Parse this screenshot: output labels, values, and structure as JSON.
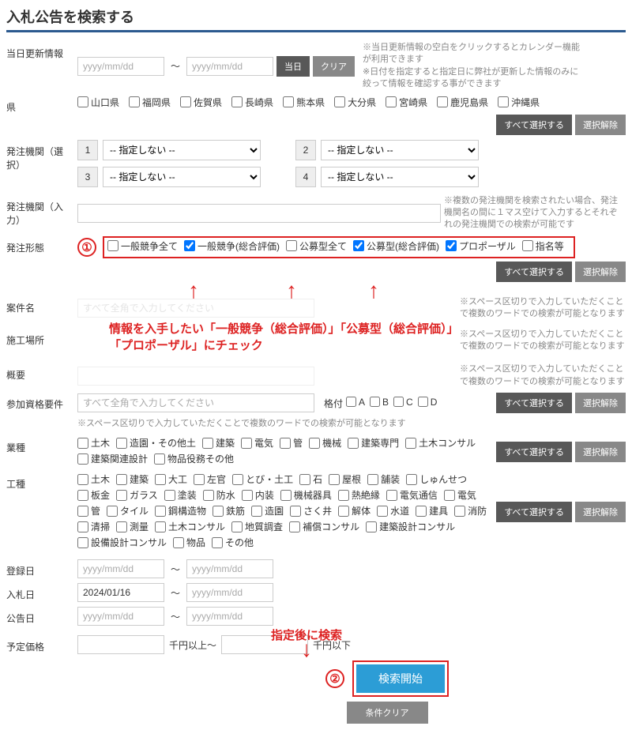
{
  "title": "入札公告を検索する",
  "labels": {
    "updateInfo": "当日更新情報",
    "pref": "県",
    "orgSelect": "発注機関（選択）",
    "orgInput": "発注機関（入力）",
    "bidType": "発注形態",
    "caseName": "案件名",
    "workPlace": "施工場所",
    "summary": "概要",
    "qualReq": "参加資格要件",
    "industry": "業種",
    "workType": "工種",
    "regDate": "登録日",
    "bidDate": "入札日",
    "noticeDate": "公告日",
    "estPrice": "予定価格"
  },
  "placeholders": {
    "date": "yyyy/mm/dd",
    "fullwidth": "すべて全角で入力してください"
  },
  "buttons": {
    "today": "当日",
    "clear": "クリア",
    "selectAll": "すべて選択する",
    "deselect": "選択解除",
    "search": "検索開始",
    "condClear": "条件クリア"
  },
  "notes": {
    "dateNote": "※当日更新情報の空白をクリックするとカレンダー機能が利用できます\n※日付を指定すると指定日に弊社が更新した情報のみに絞って情報を確認する事ができます",
    "orgInputNote": "※複数の発注機関を検索されたい場合、発注機関名の間に１マス空けて入力するとそれぞれの発注機関での検索が可能です",
    "spaceNote": "※スペース区切りで入力していただくことで複数のワードでの検索が可能となります",
    "spaceNote2": "※スペース区切りで入力していただくことで複数のワードでの検索が可能となります"
  },
  "prefs": [
    "山口県",
    "福岡県",
    "佐賀県",
    "長崎県",
    "熊本県",
    "大分県",
    "宮崎県",
    "鹿児島県",
    "沖縄県"
  ],
  "orgNums": [
    "1",
    "2",
    "3",
    "4"
  ],
  "orgDefault": "-- 指定しない --",
  "bidTypes": [
    "一般競争全て",
    "一般競争(総合評価)",
    "公募型全て",
    "公募型(総合評価)",
    "プロポーザル",
    "指名等"
  ],
  "bidChecked": [
    false,
    true,
    false,
    true,
    true,
    false
  ],
  "grades": [
    "A",
    "B",
    "C",
    "D"
  ],
  "gradeLabel": "格付",
  "industries": [
    "土木",
    "造園・その他土",
    "建築",
    "電気",
    "管",
    "機械",
    "建築専門",
    "土木コンサル",
    "建築関連設計",
    "物品役務その他"
  ],
  "workTypes": [
    "土木",
    "建築",
    "大工",
    "左官",
    "とび・土工",
    "石",
    "屋根",
    "舗装",
    "しゅんせつ",
    "板金",
    "ガラス",
    "塗装",
    "防水",
    "内装",
    "機械器具",
    "熱絶縁",
    "電気通信",
    "電気",
    "管",
    "タイル",
    "鋼構造物",
    "鉄筋",
    "造園",
    "さく井",
    "解体",
    "水道",
    "建具",
    "消防",
    "清掃",
    "測量",
    "土木コンサル",
    "地質調査",
    "補償コンサル",
    "建築設計コンサル",
    "設備設計コンサル",
    "物品",
    "その他"
  ],
  "bidDateValue": "2024/01/16",
  "priceLabels": {
    "minUnit": "千円以上～",
    "maxUnit": "千円以下"
  },
  "annotations": {
    "num1": "①",
    "num2": "②",
    "text1": "情報を入手したい「一般競争（総合評価）」「公募型（総合評価）」\n「プロポーザル」にチェック",
    "text2": "指定後に検索"
  },
  "sep": "～"
}
